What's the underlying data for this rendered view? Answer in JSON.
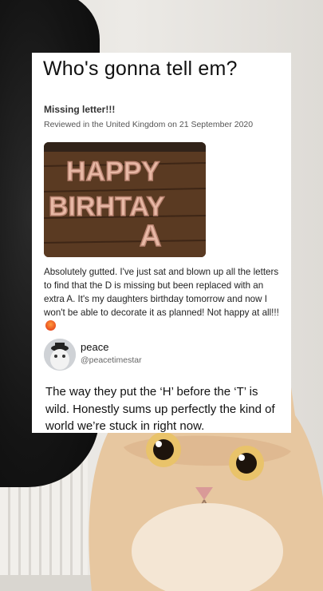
{
  "meme": {
    "caption": "Who's gonna tell em?"
  },
  "review": {
    "title": "Missing letter!!!",
    "meta": "Reviewed in the United Kingdom on 21 September 2020",
    "body": "Absolutely gutted. I've just sat and blown up all the letters to find that the D is missing but been replaced with an extra A. It's my daughters birthday tomorrow and now I won't be able to decorate it as planned! Not happy at all!!!",
    "photo_balloon_words": [
      "HAPPY",
      "BIRHTAY",
      "A"
    ]
  },
  "tweet": {
    "name": "peace",
    "handle": "@peacetimestar",
    "text": "The way they put the ‘H’ before the ‘T’ is wild. Honestly sums up perfectly the kind of world we’re stuck in right now."
  },
  "icons": {
    "emoji": "angry-face-icon"
  },
  "colors": {
    "balloon": "#e8b9a6",
    "wood": "#5a3a22"
  }
}
